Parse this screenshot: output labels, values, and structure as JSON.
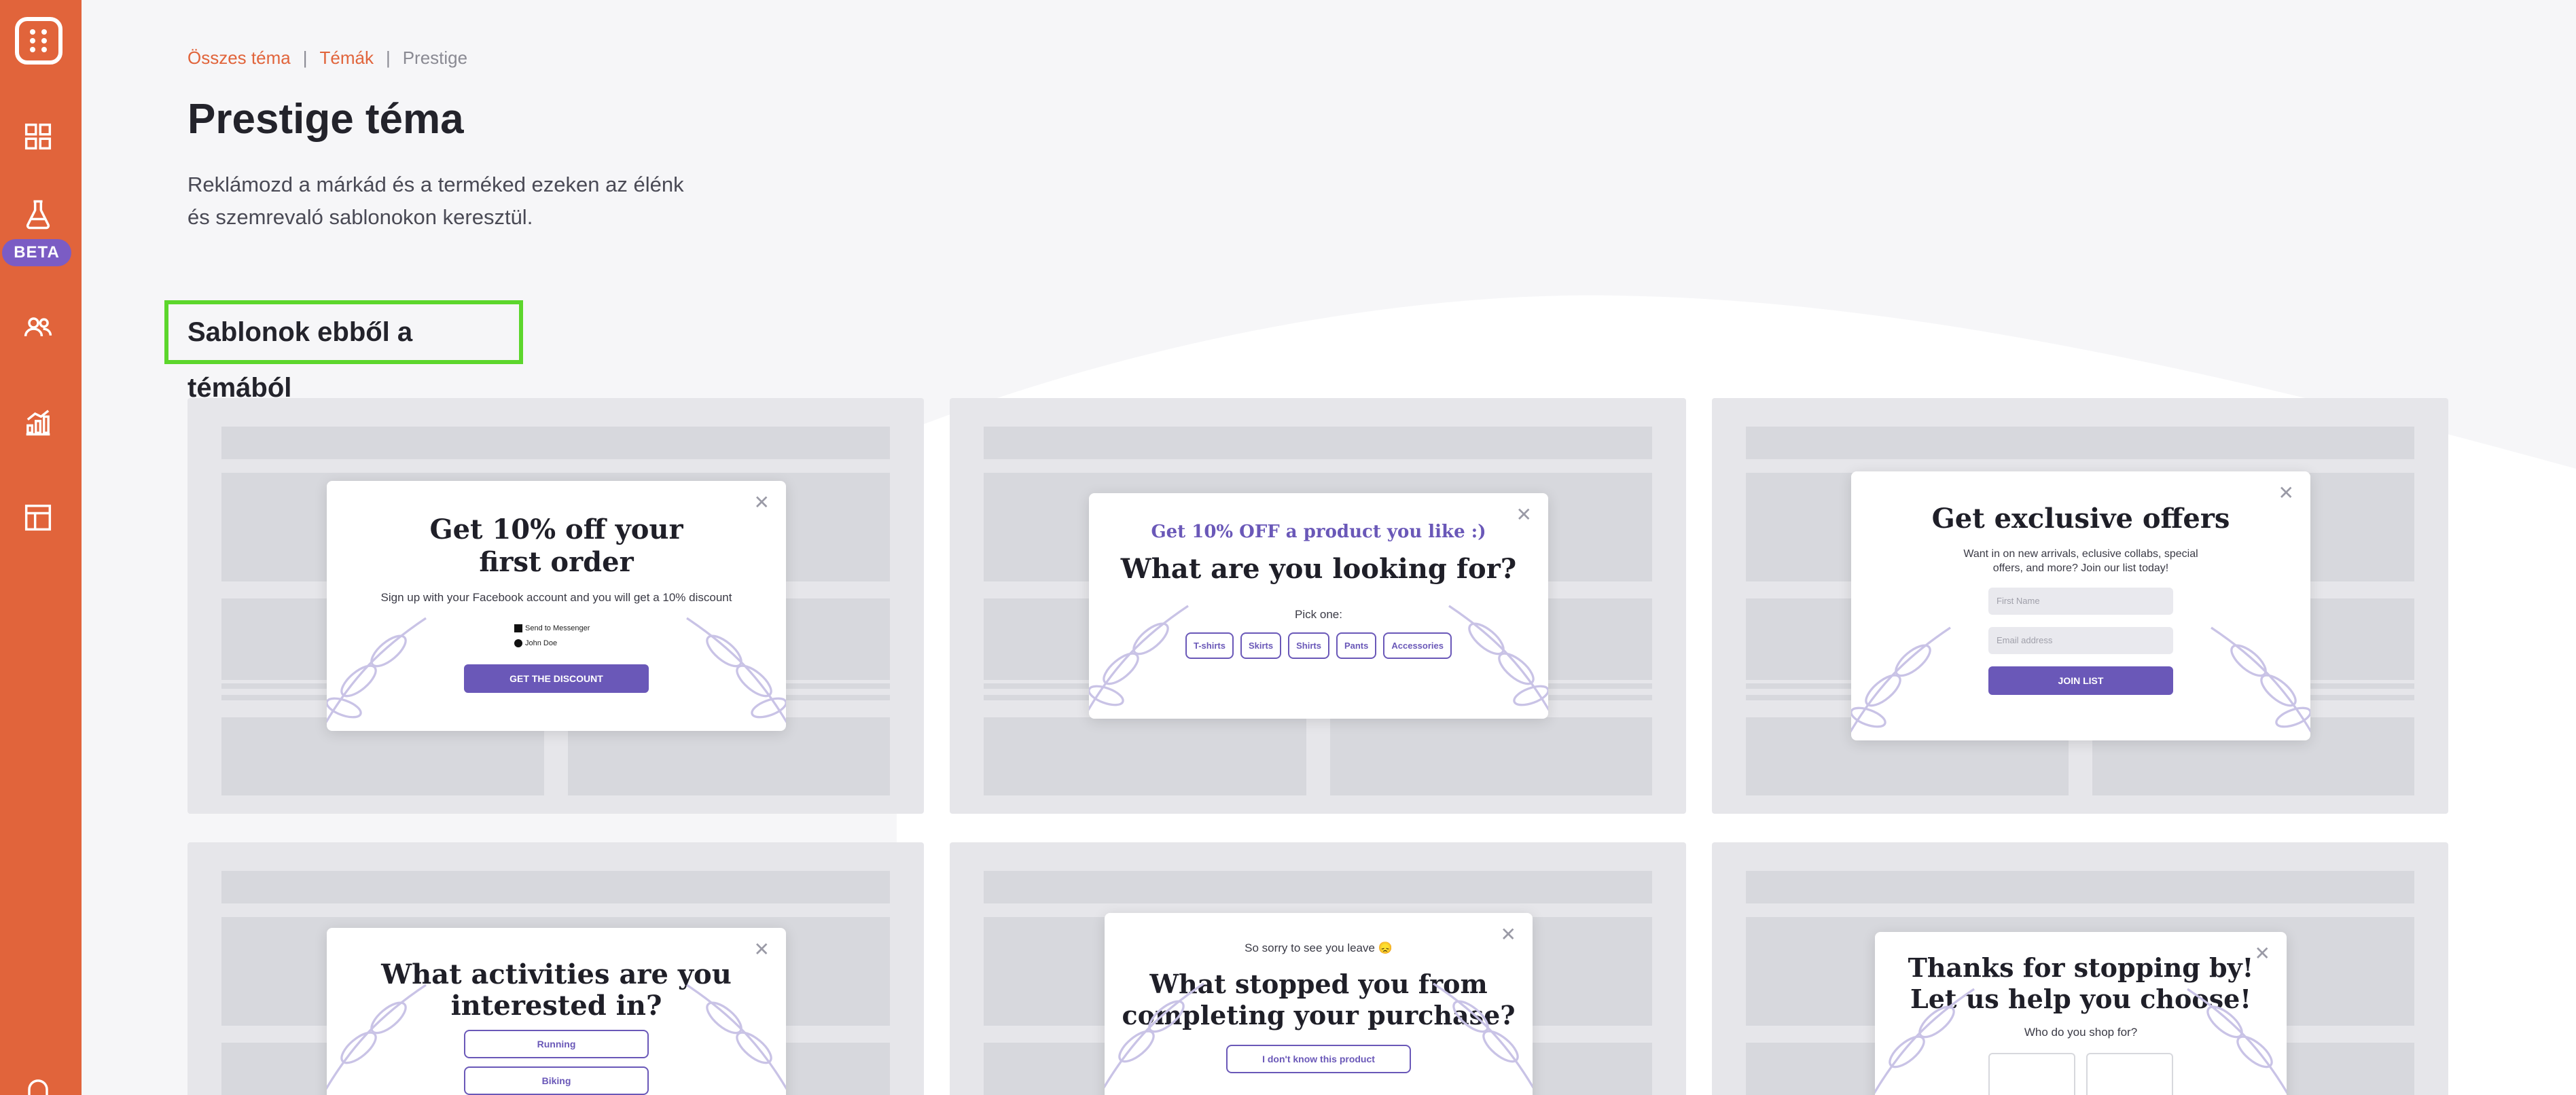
{
  "sidebar": {
    "beta_label": "BETA"
  },
  "breadcrumb": {
    "all_themes": "Összes téma",
    "themes": "Témák",
    "current": "Prestige",
    "separator": "|"
  },
  "page": {
    "title": "Prestige téma",
    "description_line1": "Reklámozd a márkád és a terméked ezeken az élénk",
    "description_line2": "és szemrevaló sablonokon keresztül.",
    "section_title": "Sablonok ebből a témából"
  },
  "colors": {
    "sidebar": "#e1643b",
    "accent": "#6a58b8",
    "beta": "#7b5cc4",
    "highlight": "#5cd62c"
  },
  "cards": [
    {
      "title_line1": "Get 10% off your",
      "title_line2": "first order",
      "subtitle": "Sign up with your Facebook account and you will get a 10% discount",
      "option1": "Send to Messenger",
      "option2": "John Doe",
      "button": "GET THE DISCOUNT"
    },
    {
      "pretitle": "Get 10% OFF a product you like :)",
      "title": "What are you looking for?",
      "prompt": "Pick one:",
      "options": [
        "T-shirts",
        "Skirts",
        "Shirts",
        "Pants",
        "Accessories"
      ]
    },
    {
      "title": "Get exclusive offers",
      "subtitle_line1": "Want in on new arrivals, eclusive collabs, special",
      "subtitle_line2": "offers, and more? Join our list today!",
      "field1": "First Name",
      "field2": "Email address",
      "button": "JOIN LIST"
    },
    {
      "title_line1": "What activities are you",
      "title_line2": "interested in?",
      "options": [
        "Running",
        "Biking"
      ]
    },
    {
      "pretitle": "So sorry to see you leave 😞",
      "title_line1": "What stopped you from",
      "title_line2": "completing your purchase?",
      "option1": "I don't know this product"
    },
    {
      "title_line1": "Thanks for stopping by!",
      "title_line2": "Let us help you choose!",
      "prompt": "Who do you shop for?"
    }
  ]
}
